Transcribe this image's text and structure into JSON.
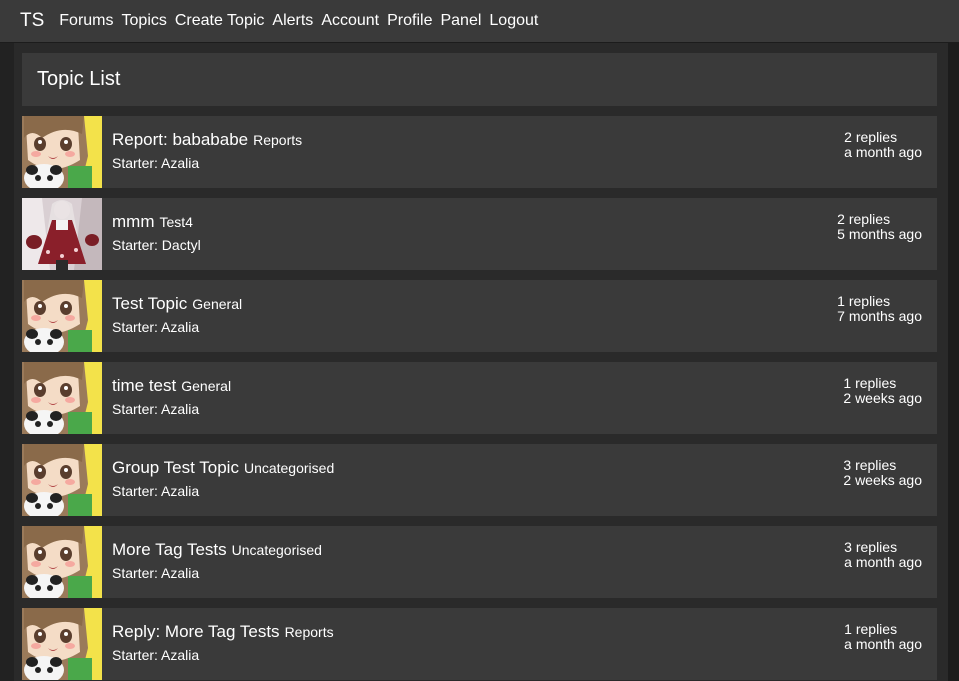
{
  "nav": {
    "brand": "TS",
    "links": [
      "Forums",
      "Topics",
      "Create Topic",
      "Alerts",
      "Account",
      "Profile",
      "Panel",
      "Logout"
    ]
  },
  "header": {
    "title": "Topic List"
  },
  "starter_prefix": "Starter:",
  "topics": [
    {
      "title": "Report: babababe",
      "forum": "Reports",
      "starter": "Azalia",
      "replies": "2 replies",
      "time": "a month ago",
      "avatar": "yellow-anime-avatar"
    },
    {
      "title": "mmm",
      "forum": "Test4",
      "starter": "Dactyl",
      "replies": "2 replies",
      "time": "5 months ago",
      "avatar": "red-dress-avatar"
    },
    {
      "title": "Test Topic",
      "forum": "General",
      "starter": "Azalia",
      "replies": "1 replies",
      "time": "7 months ago",
      "avatar": "yellow-anime-avatar"
    },
    {
      "title": "time test",
      "forum": "General",
      "starter": "Azalia",
      "replies": "1 replies",
      "time": "2 weeks ago",
      "avatar": "yellow-anime-avatar"
    },
    {
      "title": "Group Test Topic",
      "forum": "Uncategorised",
      "starter": "Azalia",
      "replies": "3 replies",
      "time": "2 weeks ago",
      "avatar": "yellow-anime-avatar"
    },
    {
      "title": "More Tag Tests",
      "forum": "Uncategorised",
      "starter": "Azalia",
      "replies": "3 replies",
      "time": "a month ago",
      "avatar": "yellow-anime-avatar"
    },
    {
      "title": "Reply: More Tag Tests",
      "forum": "Reports",
      "starter": "Azalia",
      "replies": "1 replies",
      "time": "a month ago",
      "avatar": "yellow-anime-avatar"
    }
  ],
  "colors": {
    "background": "#222222",
    "panel": "#3a3a3a",
    "text": "#ffffff"
  }
}
